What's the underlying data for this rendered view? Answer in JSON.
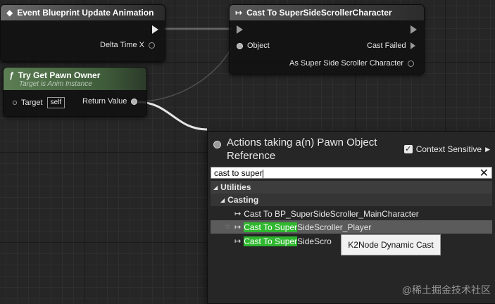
{
  "nodes": {
    "event": {
      "title": "Event Blueprint Update Animation",
      "delta_label": "Delta Time X"
    },
    "cast": {
      "title": "Cast To SuperSideScrollerCharacter",
      "object_label": "Object",
      "cast_failed_label": "Cast Failed",
      "as_label": "As Super Side Scroller Character"
    },
    "pawn": {
      "title": "Try Get Pawn Owner",
      "subtitle": "Target is Anim Instance",
      "target_label": "Target",
      "self_label": "self",
      "return_label": "Return Value"
    }
  },
  "menu": {
    "title": "Actions taking a(n) Pawn Object Reference",
    "context_label": "Context Sensitive",
    "search_value": "cast to super",
    "categories": {
      "utilities": "Utilities",
      "casting": "Casting"
    },
    "items": [
      {
        "prefix": "",
        "highlight": "",
        "rest": "Cast To BP_SuperSideScroller_MainCharacter"
      },
      {
        "prefix": "",
        "highlight": "Cast To Super",
        "rest": "SideScroller_Player"
      },
      {
        "prefix": "",
        "highlight": "Cast To Super",
        "rest": "SideScro"
      }
    ],
    "tooltip": "K2Node Dynamic Cast"
  },
  "watermark": "@稀土掘金技术社区",
  "colors": {
    "highlight": "#2fb82f",
    "pure_header": "#5c7e54",
    "background": "#262626"
  }
}
